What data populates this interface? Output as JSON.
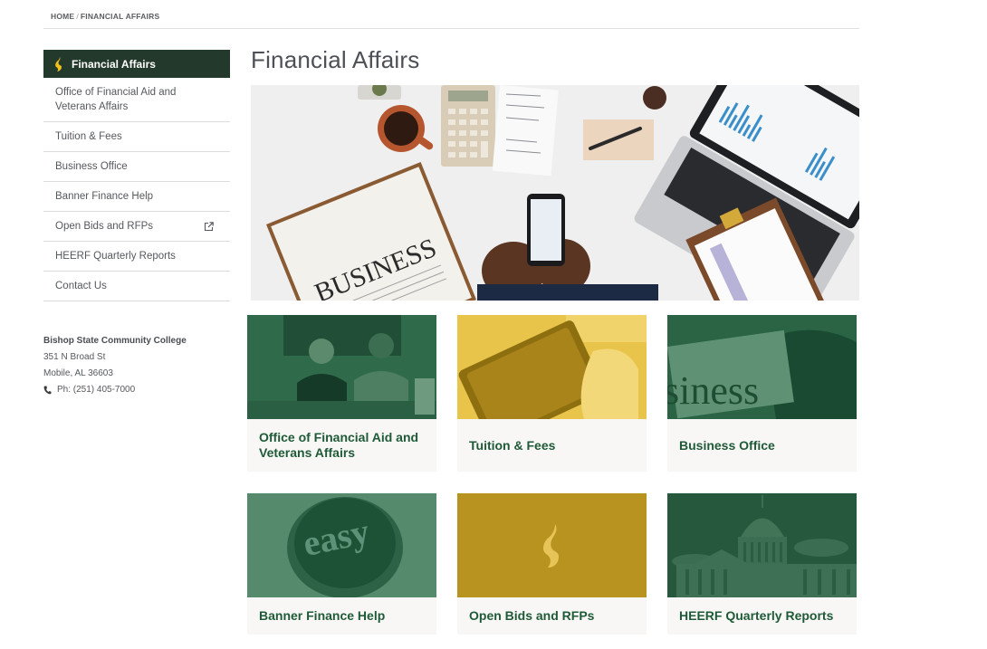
{
  "breadcrumb": {
    "home": "HOME",
    "separator": "/",
    "current": "FINANCIAL AFFAIRS"
  },
  "page": {
    "title": "Financial Affairs"
  },
  "sidebar": {
    "header": "Financial Affairs",
    "items": [
      {
        "label": "Office of Financial Aid and Veterans Affairs",
        "external": false
      },
      {
        "label": "Tuition & Fees",
        "external": false
      },
      {
        "label": "Business Office",
        "external": false
      },
      {
        "label": "Banner Finance Help",
        "external": false
      },
      {
        "label": "Open Bids and RFPs",
        "external": true
      },
      {
        "label": "HEERF Quarterly Reports",
        "external": false
      },
      {
        "label": "Contact Us",
        "external": false
      }
    ]
  },
  "address": {
    "name": "Bishop State Community College",
    "street": "351 N Broad St",
    "city": "Mobile, AL 36603",
    "phone": "Ph: (251) 405-7000"
  },
  "cards": [
    {
      "label": "Office of Financial Aid and Veterans Affairs",
      "image": "two-staff-at-desk-photo"
    },
    {
      "label": "Tuition & Fees",
      "image": "wallet-photo"
    },
    {
      "label": "Business Office",
      "image": "business-newspaper-photo"
    },
    {
      "label": "Banner Finance Help",
      "image": "easy-button-photo"
    },
    {
      "label": "Open Bids and RFPs",
      "image": "flame-logo"
    },
    {
      "label": "HEERF Quarterly Reports",
      "image": "capitol-building-photo"
    }
  ],
  "colors": {
    "brand_green": "#22392b",
    "card_title_green": "#1f5a38",
    "gold": "#b8931f"
  }
}
